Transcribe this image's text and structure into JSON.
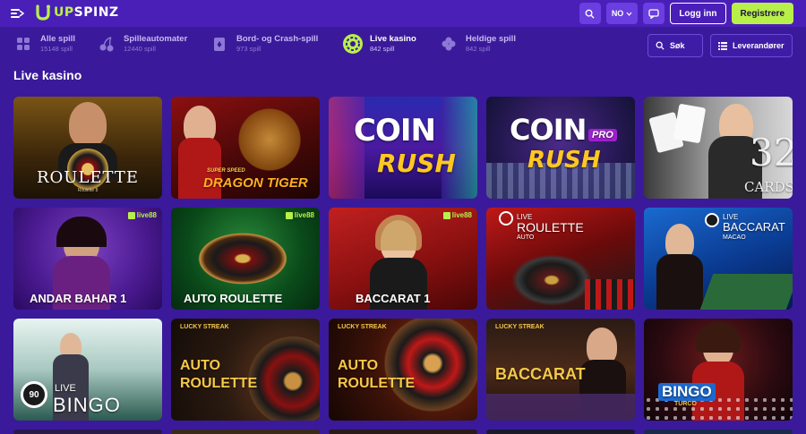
{
  "header": {
    "logo_up": "UP",
    "logo_rest": "SPINZ",
    "lang": "NO",
    "login": "Logg inn",
    "register": "Registrere"
  },
  "categories": [
    {
      "label": "Alle spill",
      "count": "15148 spill"
    },
    {
      "label": "Spilleautomater",
      "count": "12440 spill"
    },
    {
      "label": "Bord- og Crash-spill",
      "count": "973 spill"
    },
    {
      "label": "Live kasino",
      "count": "842 spill"
    },
    {
      "label": "Heldige spill",
      "count": "842 spill"
    }
  ],
  "toolbar": {
    "search": "Søk",
    "providers": "Leverandører"
  },
  "section_title": "Live kasino",
  "games": [
    {
      "title": "ROULETTE",
      "subtitle": "Roulette 8"
    },
    {
      "title": "DRAGON TIGER",
      "subtitle": "SUPER SPEED"
    },
    {
      "title": "RUSH",
      "subtitle": "COIN"
    },
    {
      "title": "RUSH",
      "subtitle": "COIN",
      "extra": "PRO"
    },
    {
      "title": "CARDS",
      "subtitle": "32"
    },
    {
      "title": "ANDAR BAHAR 1",
      "badge": "live88"
    },
    {
      "title": "AUTO ROULETTE",
      "badge": "live88"
    },
    {
      "title": "BACCARAT 1",
      "badge": "live88"
    },
    {
      "title": "ROULETTE",
      "subtitle": "LIVE",
      "extra": "AUTO"
    },
    {
      "title": "BACCARAT",
      "subtitle": "LIVE",
      "extra": "MACAO"
    },
    {
      "title": "BINGO",
      "subtitle": "LIVE",
      "extra": "90"
    },
    {
      "title": "AUTO",
      "subtitle": "ROULETTE",
      "brand": "LUCKY STREAK"
    },
    {
      "title": "AUTO",
      "subtitle": "ROULETTE",
      "brand": "LUCKY STREAK"
    },
    {
      "title": "BACCARAT",
      "brand": "LUCKY STREAK"
    },
    {
      "title": "BINGO",
      "subtitle": "TURCO"
    }
  ]
}
